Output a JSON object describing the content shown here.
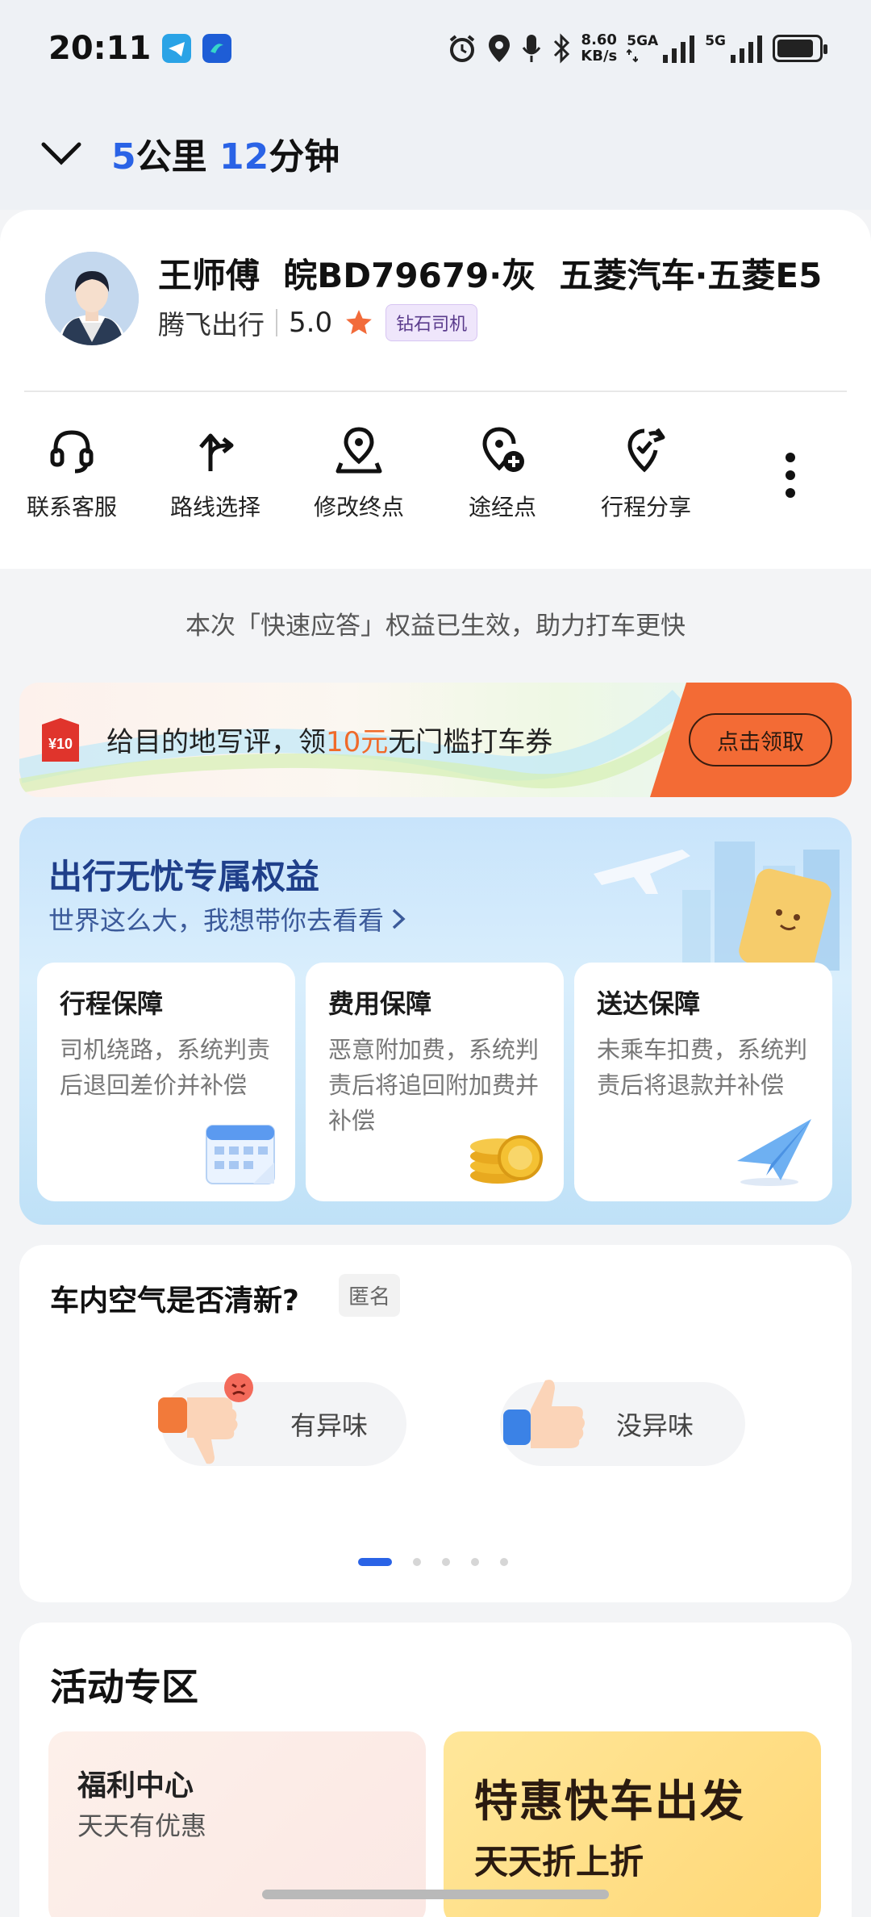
{
  "status_bar": {
    "time": "20:11",
    "net_speed_value": "8.60",
    "net_speed_unit": "KB/s",
    "signal1_label": "5GA",
    "signal2_label": "5G"
  },
  "header": {
    "distance_num": "5",
    "distance_unit": "公里",
    "time_num": "12",
    "time_unit": "分钟"
  },
  "driver": {
    "name": "王师傅",
    "plate": "皖BD79679·灰",
    "car": "五菱汽车·五菱E5",
    "company": "腾飞出行",
    "rating": "5.0",
    "badge": "钻石司机"
  },
  "actions": [
    {
      "label": "联系客服",
      "icon": "headset-icon"
    },
    {
      "label": "路线选择",
      "icon": "route-select-icon"
    },
    {
      "label": "修改终点",
      "icon": "edit-destination-icon"
    },
    {
      "label": "途经点",
      "icon": "add-waypoint-icon"
    },
    {
      "label": "行程分享",
      "icon": "share-trip-icon"
    }
  ],
  "benefit_note": "本次「快速应答」权益已生效，助力打车更快",
  "promo": {
    "coupon_tag": "¥10",
    "text_before": "给目的地写评，领",
    "text_highlight": "10元",
    "text_after": "无门槛打车券",
    "cta": "点击领取"
  },
  "benefits": {
    "title": "出行无忧专属权益",
    "subtitle": "世界这么大，我想带你去看看",
    "items": [
      {
        "title": "行程保障",
        "desc": "司机绕路，系统判责后退回差价并补偿"
      },
      {
        "title": "费用保障",
        "desc": "恶意附加费，系统判责后将追回附加费并补偿"
      },
      {
        "title": "送达保障",
        "desc": "未乘车扣费，系统判责后将退款并补偿"
      }
    ]
  },
  "air_survey": {
    "question": "车内空气是否清新?",
    "anonymous": "匿名",
    "option_bad": "有异味",
    "option_good": "没异味",
    "page_count": 5,
    "active_page": 1
  },
  "activity": {
    "title": "活动专区",
    "tile1_title": "福利中心",
    "tile1_sub": "天天有优惠",
    "tile2_title": "特惠快车出发",
    "tile2_sub": "天天折上折"
  },
  "colors": {
    "accent_blue": "#2a63e6",
    "cta_orange": "#f36b35",
    "highlight_orange": "#f06a2a",
    "star": "#f26b3a"
  }
}
